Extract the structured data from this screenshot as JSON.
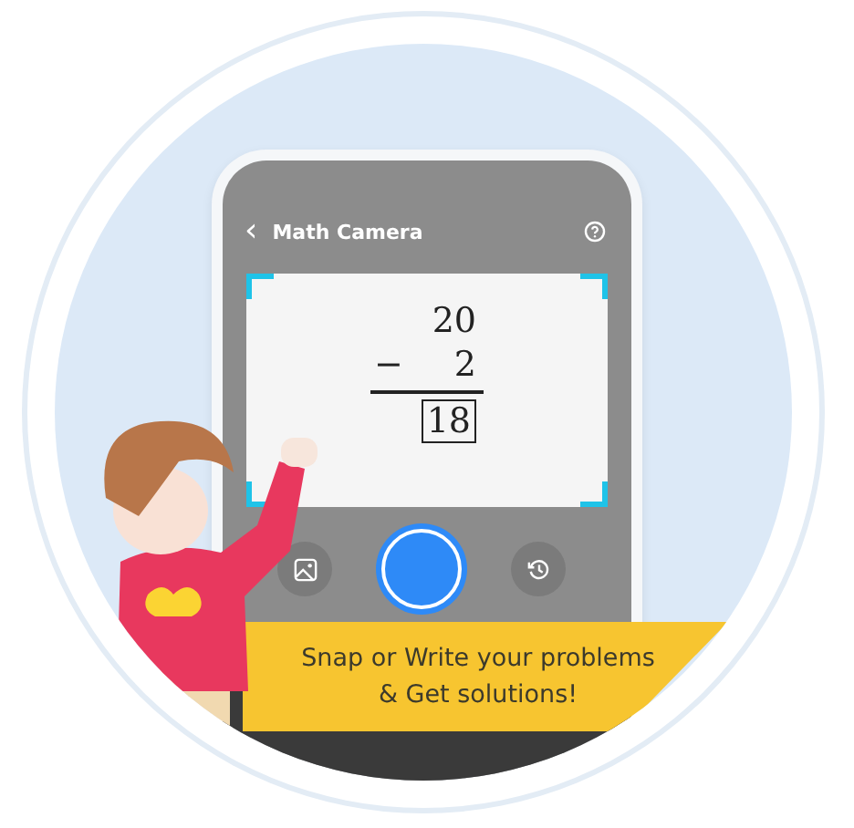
{
  "header": {
    "back": "‹",
    "title": "Math Camera"
  },
  "problem": {
    "lines": [
      {
        "kind": "number",
        "text": "20"
      },
      {
        "kind": "subtract",
        "sign": "−",
        "text": "2"
      },
      {
        "kind": "answer",
        "text": "18"
      }
    ]
  },
  "banner": {
    "lines": [
      "Snap or Write your problems",
      "& Get solutions!"
    ]
  }
}
